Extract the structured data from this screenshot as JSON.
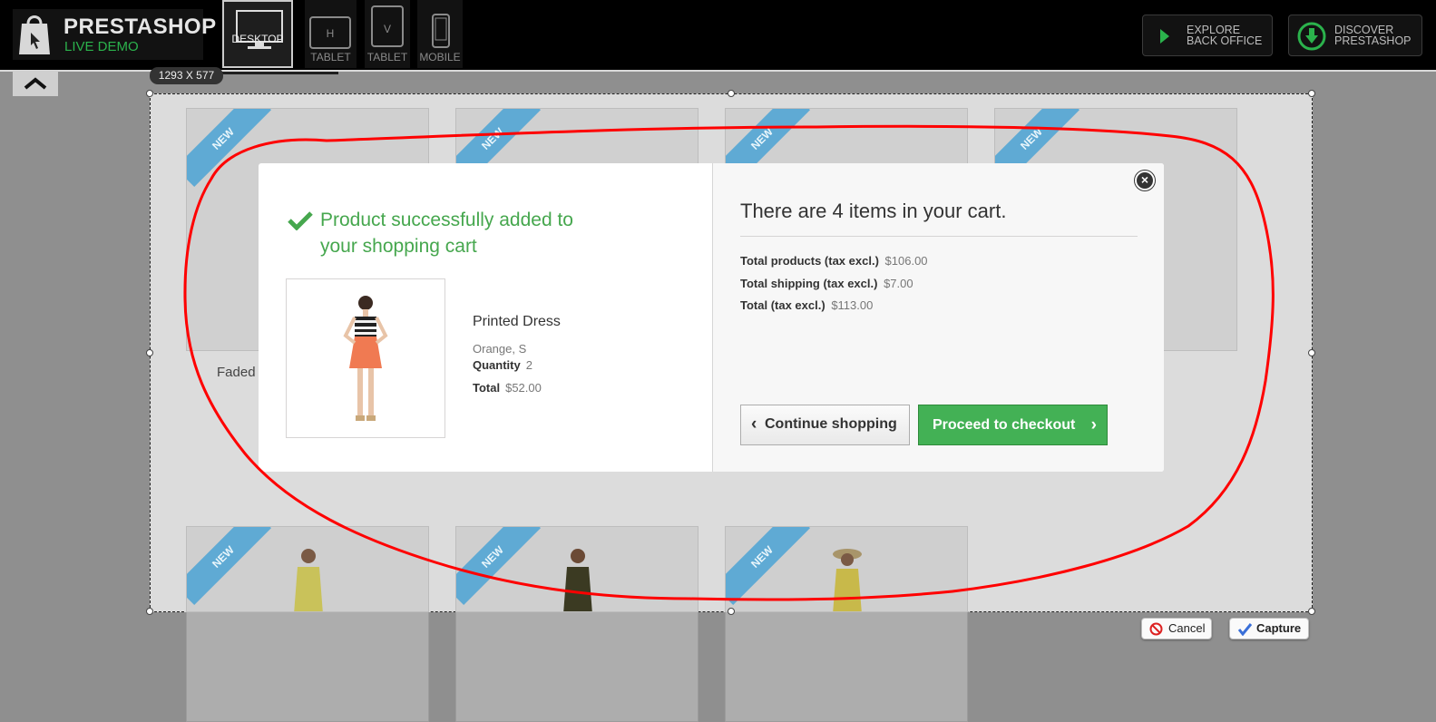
{
  "header": {
    "logo_title": "PRESTASHOP",
    "logo_subtitle": "LIVE DEMO",
    "devices": [
      {
        "label": "DESKTOP",
        "glyph": ""
      },
      {
        "label": "TABLET",
        "glyph": "H"
      },
      {
        "label": "TABLET",
        "glyph": "V"
      },
      {
        "label": "MOBILE",
        "glyph": ""
      }
    ],
    "explore_line1": "EXPLORE",
    "explore_line2": "BACK OFFICE",
    "discover_line1": "DISCOVER",
    "discover_line2": "PRESTASHOP"
  },
  "capture": {
    "size_label": "1293 X 577",
    "cancel_label": "Cancel",
    "capture_label": "Capture"
  },
  "products": {
    "ribbon": "NEW",
    "faded_label": "Faded"
  },
  "modal": {
    "success_message": "Product successfully added to your shopping cart",
    "product_name": "Printed Dress",
    "product_attributes": "Orange, S",
    "quantity_label": "Quantity",
    "quantity_value": "2",
    "total_label": "Total",
    "total_value": "$52.00",
    "cart_title": "There are 4 items in your cart.",
    "total_products_label": "Total products (tax excl.)",
    "total_products_value": "$106.00",
    "total_shipping_label": "Total shipping (tax excl.)",
    "total_shipping_value": "$7.00",
    "grand_total_label": "Total (tax excl.)",
    "grand_total_value": "$113.00",
    "continue_label": "Continue shopping",
    "checkout_label": "Proceed to checkout"
  },
  "colors": {
    "success_green": "#46a74e",
    "checkout_green": "#43b155",
    "ribbon_blue": "#5faad4",
    "annotation_red": "#ff0000"
  }
}
